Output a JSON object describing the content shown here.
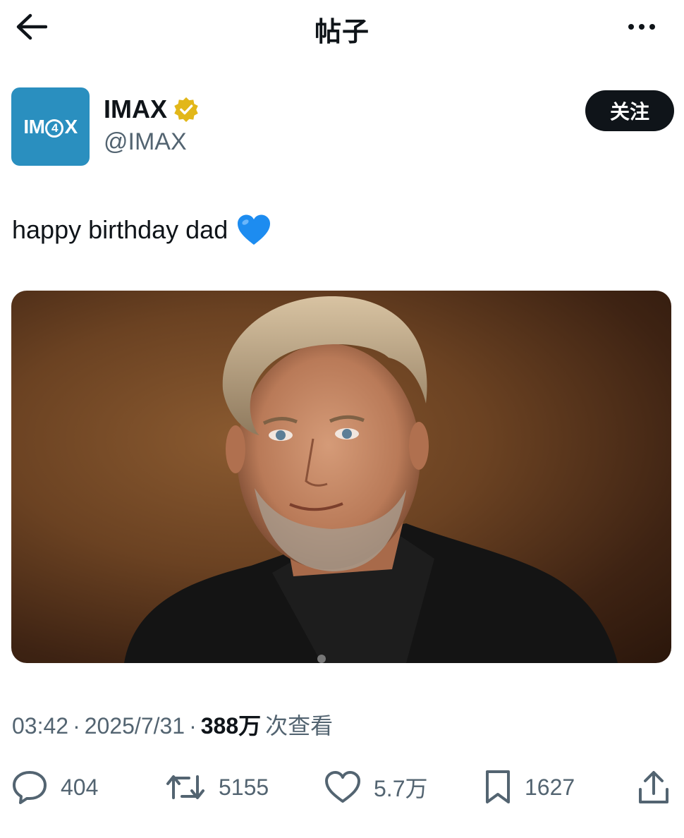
{
  "header": {
    "title": "帖子"
  },
  "author": {
    "display_name": "IMAX",
    "handle": "@IMAX",
    "verified": true,
    "avatar_text": "IMAX",
    "follow_label": "关注"
  },
  "tweet": {
    "text": "happy birthday dad",
    "emoji": "blue-heart"
  },
  "meta": {
    "time": "03:42",
    "separator": "·",
    "date": "2025/7/31",
    "views": "388万",
    "views_suffix": "次查看"
  },
  "actions": {
    "replies": "404",
    "retweets": "5155",
    "likes": "5.7万",
    "bookmarks": "1627"
  },
  "colors": {
    "text": "#0f1419",
    "secondary": "#536471",
    "avatar_bg": "#2a8fbf",
    "verified_badge": "#e2b719",
    "heart": "#1d8cf0"
  }
}
